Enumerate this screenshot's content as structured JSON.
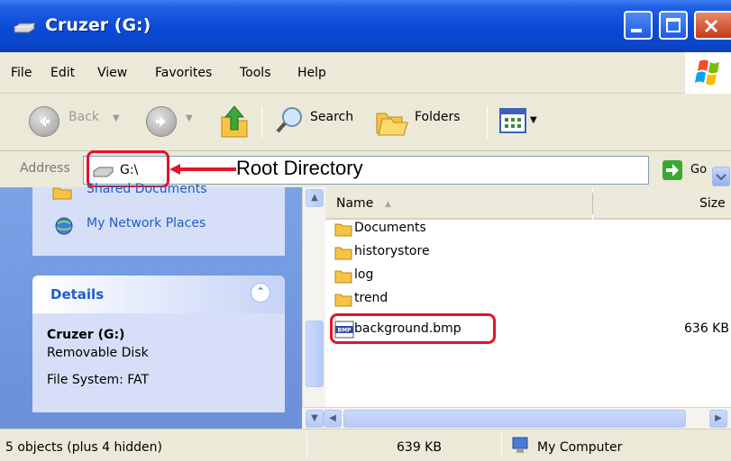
{
  "window": {
    "title": "Cruzer (G:)"
  },
  "menu": {
    "items": [
      "File",
      "Edit",
      "View",
      "Favorites",
      "Tools",
      "Help"
    ]
  },
  "toolbar": {
    "back_label": "Back",
    "search_label": "Search",
    "folders_label": "Folders"
  },
  "address": {
    "label": "Address",
    "value": "G:\\",
    "go_label": "Go"
  },
  "annotation": {
    "callout_text": "Root Directory",
    "highlight_color": "#e4132a"
  },
  "left_panel": {
    "links": [
      "Shared Documents",
      "My Network Places"
    ],
    "details": {
      "title": "Details",
      "name": "Cruzer (G:)",
      "type": "Removable Disk",
      "file_system": "File System: FAT"
    }
  },
  "file_list": {
    "columns": [
      "Name",
      "Size"
    ],
    "rows": [
      {
        "name": "Documents",
        "size": "",
        "icon": "folder-icon"
      },
      {
        "name": "historystore",
        "size": "",
        "icon": "folder-icon"
      },
      {
        "name": "log",
        "size": "",
        "icon": "folder-icon"
      },
      {
        "name": "trend",
        "size": "",
        "icon": "folder-icon"
      },
      {
        "name": "background.bmp",
        "size": "636 KB",
        "icon": "bmp-file-icon"
      }
    ]
  },
  "status_bar": {
    "objects": "5 objects (plus 4 hidden)",
    "size": "639 KB",
    "location": "My Computer"
  },
  "colors": {
    "titlebar": "#0a4ad6",
    "panel_blue": "#7ba2e7",
    "link_blue": "#215dc6",
    "chrome": "#ece9d8"
  }
}
